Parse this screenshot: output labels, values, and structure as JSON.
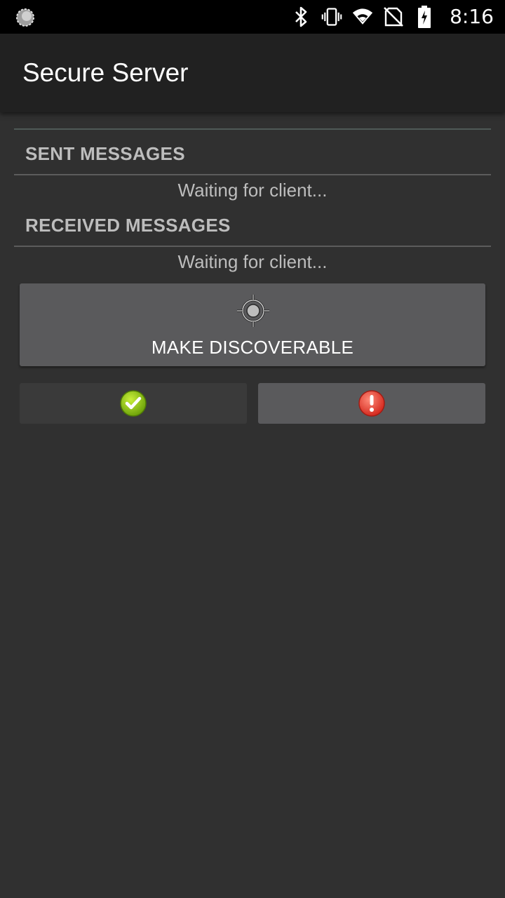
{
  "status_bar": {
    "time": "8:16",
    "icons": [
      "loading-spinner-icon",
      "bluetooth-icon",
      "vibrate-icon",
      "wifi-icon",
      "no-sim-icon",
      "battery-charging-icon"
    ]
  },
  "app_bar": {
    "title": "Secure Server"
  },
  "sent": {
    "header": "SENT MESSAGES",
    "status": "Waiting for client..."
  },
  "received": {
    "header": "RECEIVED MESSAGES",
    "status": "Waiting for client..."
  },
  "discover_button": {
    "label": "MAKE DISCOVERABLE",
    "icon": "target-location-icon"
  },
  "action_buttons": {
    "ok_icon": "green-check-icon",
    "error_icon": "red-exclamation-icon",
    "ok_color": "#8bc20f",
    "error_color": "#e63a2e"
  }
}
